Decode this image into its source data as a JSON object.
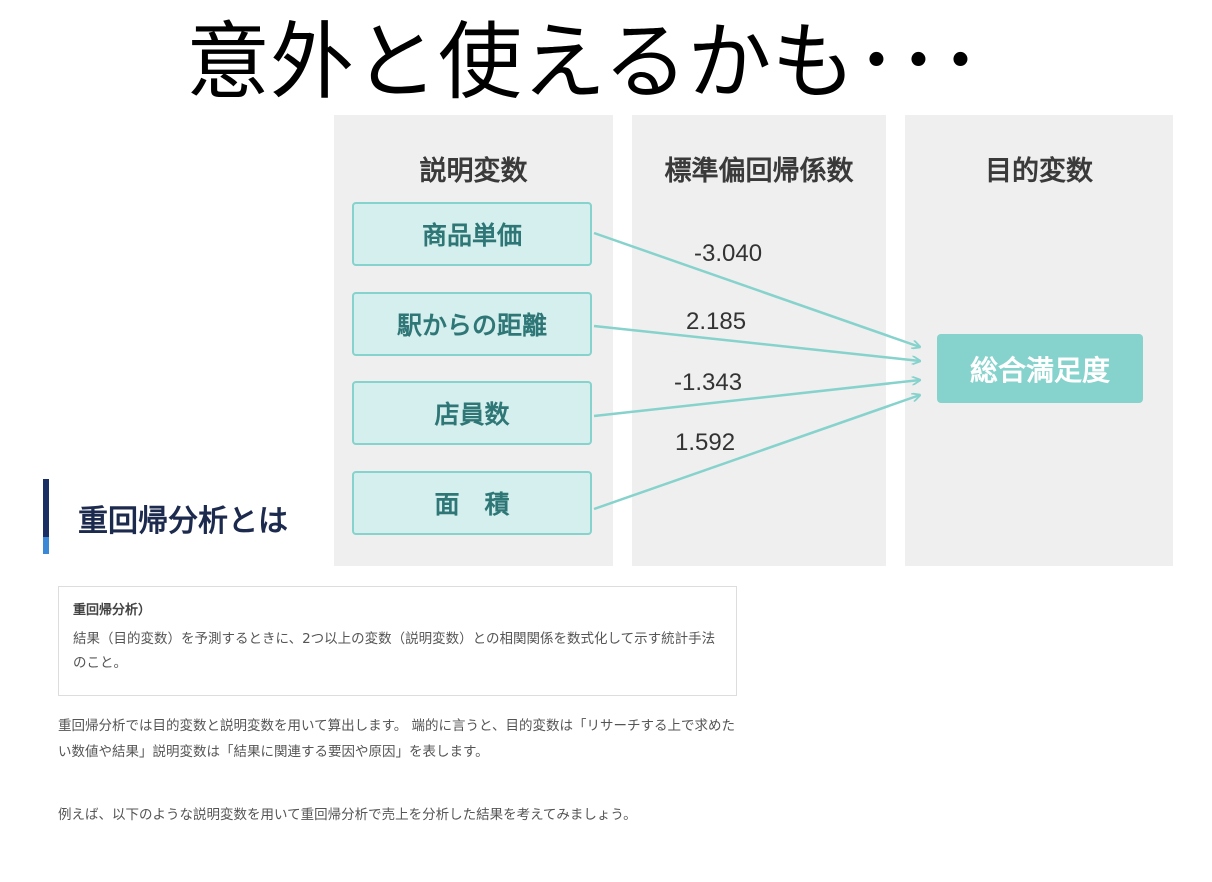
{
  "title": "意外と使えるかも･･･",
  "diagram": {
    "columns": {
      "explanatory": "説明変数",
      "coefficient": "標準偏回帰係数",
      "target": "目的変数"
    },
    "variables": [
      {
        "label": "商品単価",
        "coefficient": "-3.040"
      },
      {
        "label": "駅からの距離",
        "coefficient": "2.185"
      },
      {
        "label": "店員数",
        "coefficient": "-1.343"
      },
      {
        "label": "面　積",
        "coefficient": "1.592"
      }
    ],
    "target_label": "総合満足度",
    "colors": {
      "column_bg": "#efefef",
      "box_fill": "#d4efed",
      "box_border": "#86d2cc",
      "box_text": "#2f7777",
      "target_fill": "#86d2cc",
      "arrow": "#86d2cc"
    }
  },
  "article": {
    "heading": "重回帰分析とは",
    "definition_title": "重回帰分析）",
    "definition_text": "結果（目的変数）を予測するときに、2つ以上の変数（説明変数）との相関関係を数式化して示す統計手法のこと。",
    "paragraph1": "重回帰分析では目的変数と説明変数を用いて算出します。 端的に言うと、目的変数は「リサーチする上で求めたい数値や結果」説明変数は「結果に関連する要因や原因」を表します。",
    "paragraph2": "例えば、以下のような説明変数を用いて重回帰分析で売上を分析した結果を考えてみましょう。"
  }
}
